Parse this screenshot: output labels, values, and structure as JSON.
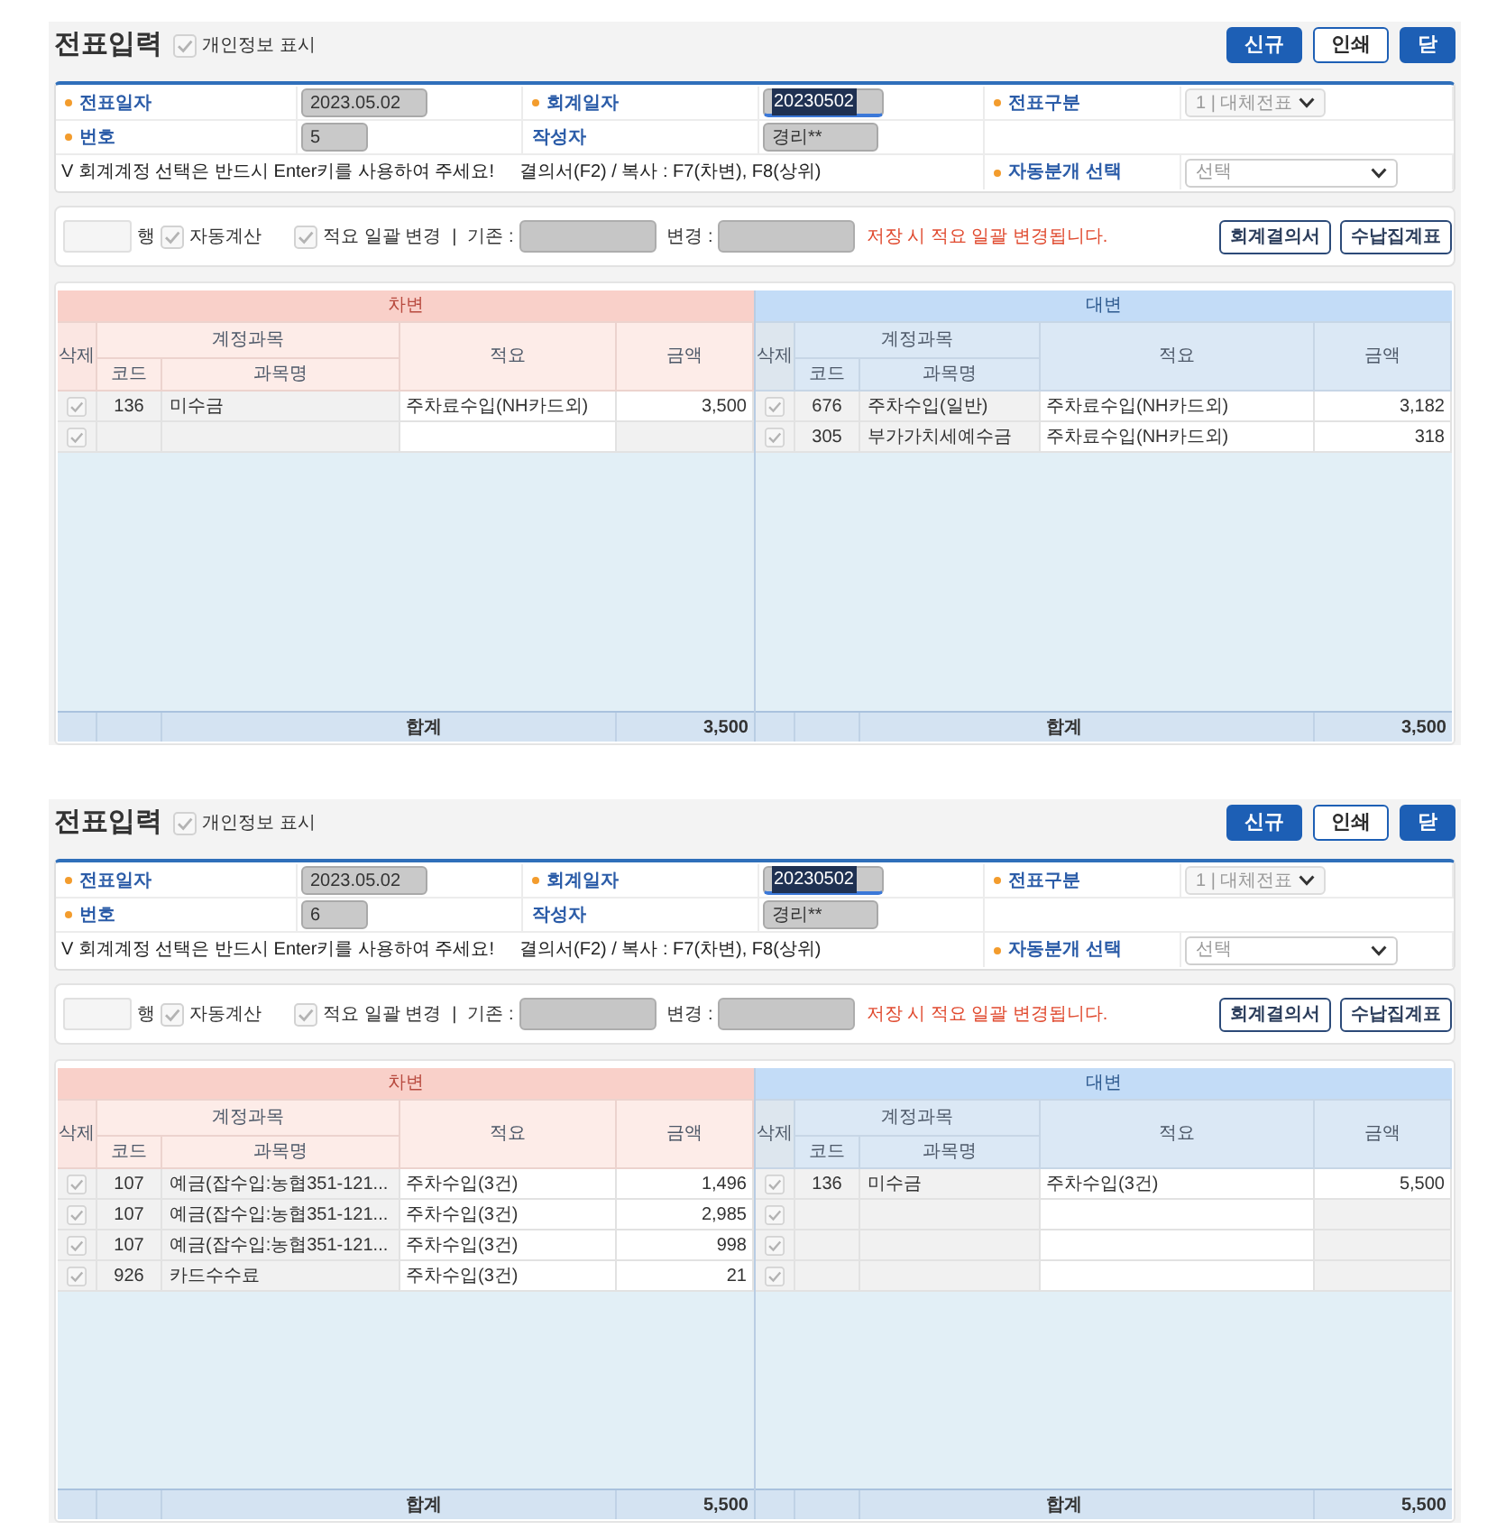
{
  "panels": [
    {
      "title": "전표입력",
      "privacy": {
        "label": "개인정보 표시",
        "checked": true
      },
      "buttons": [
        {
          "label": "신규",
          "kind": "primary"
        },
        {
          "label": "인쇄",
          "kind": "outline"
        },
        {
          "label": "닫",
          "kind": "primary"
        }
      ],
      "form": {
        "fields": [
          {
            "label": "전표일자",
            "required": true,
            "kind": "input",
            "value": "2023.05.02",
            "highlighted": false,
            "disabled": false
          },
          {
            "label": "회계일자",
            "required": true,
            "kind": "input",
            "value": "20230502",
            "highlighted": true,
            "disabled": false
          },
          {
            "label": "전표구분",
            "required": true,
            "kind": "select",
            "value": "1 | 대체전표",
            "highlighted": false,
            "disabled": true
          },
          {
            "label": "번호",
            "required": true,
            "kind": "input",
            "value": "5",
            "highlighted": false,
            "disabled": false
          },
          {
            "label": "작성자",
            "required": false,
            "kind": "input",
            "value": "경리**",
            "highlighted": false,
            "disabled": false
          },
          {
            "label": "자동분개 선택",
            "required": true,
            "kind": "select",
            "placeholder": "선택",
            "highlighted": false,
            "disabled": false
          }
        ],
        "notes": [
          "V 회계계정 선택은 반드시 Enter키를 사용하여 주세요!",
          "결의서(F2) / 복사 : F7(차변), F8(상위)"
        ]
      },
      "toolbar": {
        "row_unit": "행",
        "checks": [
          {
            "label": "자동계산",
            "checked": true
          },
          {
            "label": "적요 일괄 변경",
            "checked": true
          }
        ],
        "separator": "|",
        "old_label": "기존 :",
        "new_label": "변경 :",
        "notice": "저장 시 적요 일괄 변경됩니다.",
        "buttons": [
          "회계결의서",
          "수납집계표"
        ]
      },
      "table": {
        "sides": [
          {
            "kind": "debit",
            "title": "차변",
            "columns": {
              "delete": "삭제",
              "account_group": "계정과목",
              "code": "코드",
              "account": "과목명",
              "memo": "적요",
              "amount": "금액"
            },
            "rows": [
              {
                "checked": true,
                "code": "136",
                "account": "미수금",
                "memo": "주차료수입(NH카드외)",
                "amount": "3,500"
              },
              {
                "checked": true
              }
            ],
            "total_label": "합계",
            "total": "3,500"
          },
          {
            "kind": "credit",
            "title": "대변",
            "columns": {
              "delete": "삭제",
              "account_group": "계정과목",
              "code": "코드",
              "account": "과목명",
              "memo": "적요",
              "amount": "금액"
            },
            "rows": [
              {
                "checked": true,
                "code": "676",
                "account": "주차수입(일반)",
                "memo": "주차료수입(NH카드외)",
                "amount": "3,182"
              },
              {
                "checked": true,
                "code": "305",
                "account": "부가가치세예수금",
                "memo": "주차료수입(NH카드외)",
                "amount": "318"
              }
            ],
            "total_label": "합계",
            "total": "3,500"
          }
        ]
      }
    },
    {
      "title": "전표입력",
      "privacy": {
        "label": "개인정보 표시",
        "checked": true
      },
      "buttons": [
        {
          "label": "신규",
          "kind": "primary"
        },
        {
          "label": "인쇄",
          "kind": "outline"
        },
        {
          "label": "닫",
          "kind": "primary"
        }
      ],
      "form": {
        "fields": [
          {
            "label": "전표일자",
            "required": true,
            "kind": "input",
            "value": "2023.05.02",
            "highlighted": false,
            "disabled": false
          },
          {
            "label": "회계일자",
            "required": true,
            "kind": "input",
            "value": "20230502",
            "highlighted": true,
            "disabled": false
          },
          {
            "label": "전표구분",
            "required": true,
            "kind": "select",
            "value": "1 | 대체전표",
            "highlighted": false,
            "disabled": true
          },
          {
            "label": "번호",
            "required": true,
            "kind": "input",
            "value": "6",
            "highlighted": false,
            "disabled": false
          },
          {
            "label": "작성자",
            "required": false,
            "kind": "input",
            "value": "경리**",
            "highlighted": false,
            "disabled": false
          },
          {
            "label": "자동분개 선택",
            "required": true,
            "kind": "select",
            "placeholder": "선택",
            "highlighted": false,
            "disabled": false
          }
        ],
        "notes": [
          "V 회계계정 선택은 반드시 Enter키를 사용하여 주세요!",
          "결의서(F2) / 복사 : F7(차변), F8(상위)"
        ]
      },
      "toolbar": {
        "row_unit": "행",
        "checks": [
          {
            "label": "자동계산",
            "checked": true
          },
          {
            "label": "적요 일괄 변경",
            "checked": true
          }
        ],
        "separator": "|",
        "old_label": "기존 :",
        "new_label": "변경 :",
        "notice": "저장 시 적요 일괄 변경됩니다.",
        "buttons": [
          "회계결의서",
          "수납집계표"
        ]
      },
      "table": {
        "sides": [
          {
            "kind": "debit",
            "title": "차변",
            "columns": {
              "delete": "삭제",
              "account_group": "계정과목",
              "code": "코드",
              "account": "과목명",
              "memo": "적요",
              "amount": "금액"
            },
            "rows": [
              {
                "checked": true,
                "code": "107",
                "account": "예금(잡수입:농협351-121...",
                "memo": "주차수입(3건)",
                "amount": "1,496"
              },
              {
                "checked": true,
                "code": "107",
                "account": "예금(잡수입:농협351-121...",
                "memo": "주차수입(3건)",
                "amount": "2,985"
              },
              {
                "checked": true,
                "code": "107",
                "account": "예금(잡수입:농협351-121...",
                "memo": "주차수입(3건)",
                "amount": "998"
              },
              {
                "checked": true,
                "code": "926",
                "account": "카드수수료",
                "memo": "주차수입(3건)",
                "amount": "21"
              }
            ],
            "total_label": "합계",
            "total": "5,500"
          },
          {
            "kind": "credit",
            "title": "대변",
            "columns": {
              "delete": "삭제",
              "account_group": "계정과목",
              "code": "코드",
              "account": "과목명",
              "memo": "적요",
              "amount": "금액"
            },
            "rows": [
              {
                "checked": true,
                "code": "136",
                "account": "미수금",
                "memo": "주차수입(3건)",
                "amount": "5,500"
              },
              {
                "checked": true
              },
              {
                "checked": true
              },
              {
                "checked": true
              }
            ],
            "total_label": "합계",
            "total": "5,500"
          }
        ]
      }
    }
  ]
}
